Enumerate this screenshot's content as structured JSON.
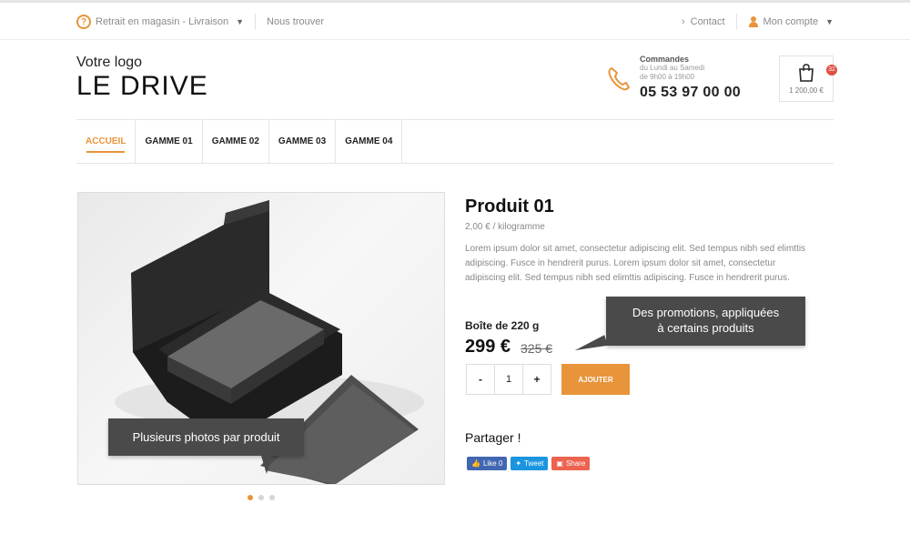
{
  "topbar": {
    "delivery_label": "Retrait en magasin - Livraison",
    "find_us": "Nous trouver",
    "contact": "Contact",
    "account": "Mon compte"
  },
  "brand": {
    "logo_small": "Votre logo",
    "logo_big": "LE DRIVE"
  },
  "contact": {
    "title": "Commandes",
    "hours_line1": "du Lundi au Samedi",
    "hours_line2": "de 9h00 à 19h00",
    "phone": "05 53 97 00 00"
  },
  "cart": {
    "count": "32",
    "total": "1 200,00 €"
  },
  "nav": {
    "items": [
      "ACCUEIL",
      "GAMME 01",
      "GAMME 02",
      "GAMME 03",
      "GAMME 04"
    ],
    "active": "ACCUEIL"
  },
  "product": {
    "title": "Produit 01",
    "unit_price": "2,00 € / kilogramme",
    "description": "Lorem ipsum dolor sit amet, consectetur adipiscing elit. Sed tempus nibh sed elimttis adipiscing. Fusce in hendrerit purus. Lorem ipsum dolor sit amet, consectetur adipiscing elit. Sed tempus nibh sed elimttis adipiscing. Fusce in hendrerit purus.",
    "box_label": "Boîte de 220 g",
    "price": "299 €",
    "old_price": "325 €",
    "quantity": "1",
    "minus": "-",
    "plus": "+",
    "add_label": "AJOUTER",
    "share_title": "Partager !"
  },
  "share": {
    "facebook": "Like 0",
    "twitter": "Tweet",
    "share": "Share"
  },
  "gallery": {
    "slides": 3,
    "active_slide": 1
  },
  "tooltips": {
    "photos": "Plusieurs photos par produit",
    "promo_line1": "Des promotions, appliquées",
    "promo_line2": "à certains produits"
  },
  "colors": {
    "accent": "#e8943a",
    "tooltip": "#4a4a4a",
    "facebook": "#4267b2",
    "twitter": "#1b95e0",
    "share": "#ec6350"
  }
}
